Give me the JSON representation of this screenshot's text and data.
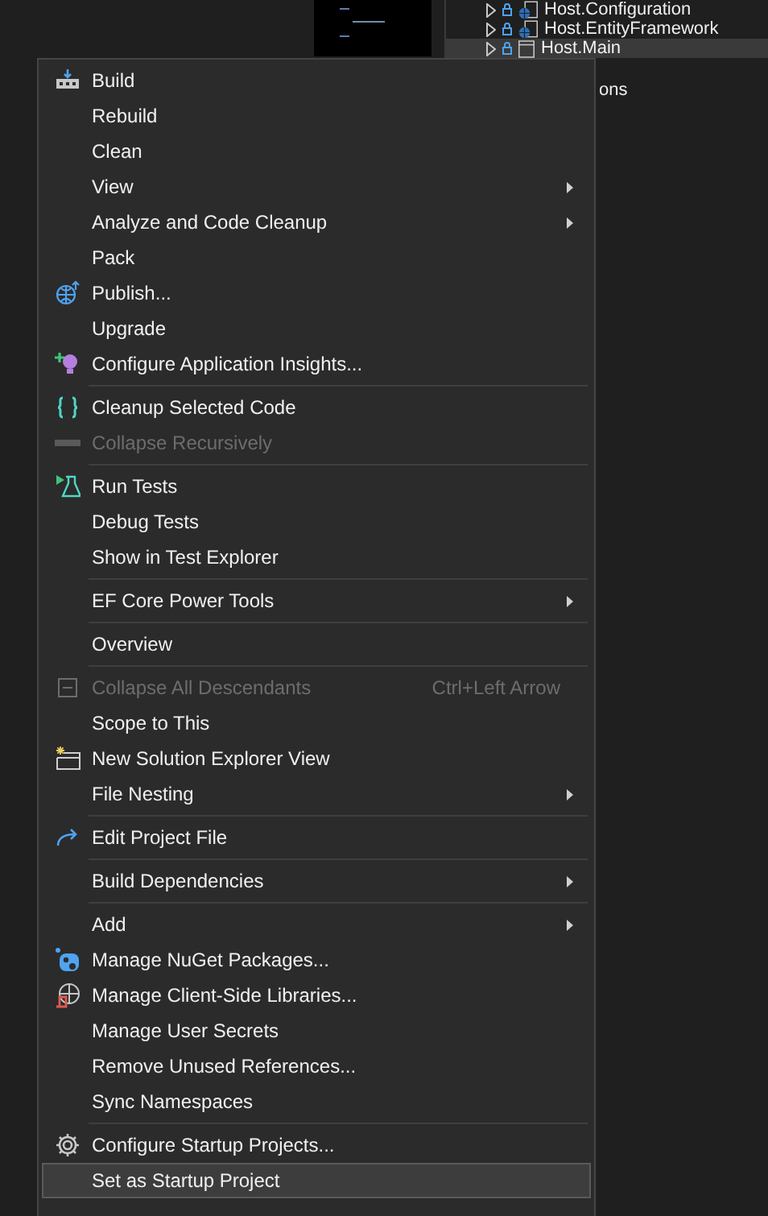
{
  "solution_explorer": {
    "items": [
      {
        "kind": "project",
        "label": "Host.Configuration",
        "selected": false
      },
      {
        "kind": "project",
        "label": "Host.EntityFramework",
        "selected": false
      },
      {
        "kind": "project",
        "label": "Host.Main",
        "selected": true
      },
      {
        "kind": "text",
        "label": "ons",
        "selected": false
      }
    ]
  },
  "context_menu": {
    "items": [
      {
        "kind": "item",
        "label": "Build",
        "selected": false
      },
      {
        "kind": "item",
        "label": "Rebuild",
        "selected": false
      },
      {
        "kind": "item",
        "label": "Clean",
        "selected": false
      },
      {
        "kind": "item",
        "label": "View",
        "submenu": true,
        "selected": false
      },
      {
        "kind": "item",
        "label": "Analyze and Code Cleanup",
        "submenu": true,
        "selected": false
      },
      {
        "kind": "item",
        "label": "Pack",
        "selected": false
      },
      {
        "kind": "item",
        "label": "Publish...",
        "selected": false
      },
      {
        "kind": "item",
        "label": "Upgrade",
        "selected": false
      },
      {
        "kind": "item",
        "label": "Configure Application Insights...",
        "selected": false
      },
      {
        "kind": "separator"
      },
      {
        "kind": "item",
        "label": "Cleanup Selected Code",
        "selected": false
      },
      {
        "kind": "item",
        "label": "Collapse Recursively",
        "disabled": true,
        "selected": false
      },
      {
        "kind": "separator"
      },
      {
        "kind": "item",
        "label": "Run Tests",
        "selected": false
      },
      {
        "kind": "item",
        "label": "Debug Tests",
        "selected": false
      },
      {
        "kind": "item",
        "label": "Show in Test Explorer",
        "selected": false
      },
      {
        "kind": "separator"
      },
      {
        "kind": "item",
        "label": "EF Core Power Tools",
        "submenu": true,
        "selected": false
      },
      {
        "kind": "separator"
      },
      {
        "kind": "item",
        "label": "Overview",
        "selected": false
      },
      {
        "kind": "separator"
      },
      {
        "kind": "item",
        "label": "Collapse All Descendants",
        "shortcut": "Ctrl+Left Arrow",
        "disabled": true,
        "selected": false
      },
      {
        "kind": "item",
        "label": "Scope to This",
        "selected": false
      },
      {
        "kind": "item",
        "label": "New Solution Explorer View",
        "selected": false
      },
      {
        "kind": "item",
        "label": "File Nesting",
        "submenu": true,
        "selected": false
      },
      {
        "kind": "separator"
      },
      {
        "kind": "item",
        "label": "Edit Project File",
        "selected": false
      },
      {
        "kind": "separator"
      },
      {
        "kind": "item",
        "label": "Build Dependencies",
        "submenu": true,
        "selected": false
      },
      {
        "kind": "separator"
      },
      {
        "kind": "item",
        "label": "Add",
        "submenu": true,
        "selected": false
      },
      {
        "kind": "item",
        "label": "Manage NuGet Packages...",
        "selected": false
      },
      {
        "kind": "item",
        "label": "Manage Client-Side Libraries...",
        "selected": false
      },
      {
        "kind": "item",
        "label": "Manage User Secrets",
        "selected": false
      },
      {
        "kind": "item",
        "label": "Remove Unused References...",
        "selected": false
      },
      {
        "kind": "item",
        "label": "Sync Namespaces",
        "selected": false
      },
      {
        "kind": "separator"
      },
      {
        "kind": "item",
        "label": "Configure Startup Projects...",
        "selected": false
      },
      {
        "kind": "item",
        "label": "Set as Startup Project",
        "selected": true
      }
    ]
  }
}
